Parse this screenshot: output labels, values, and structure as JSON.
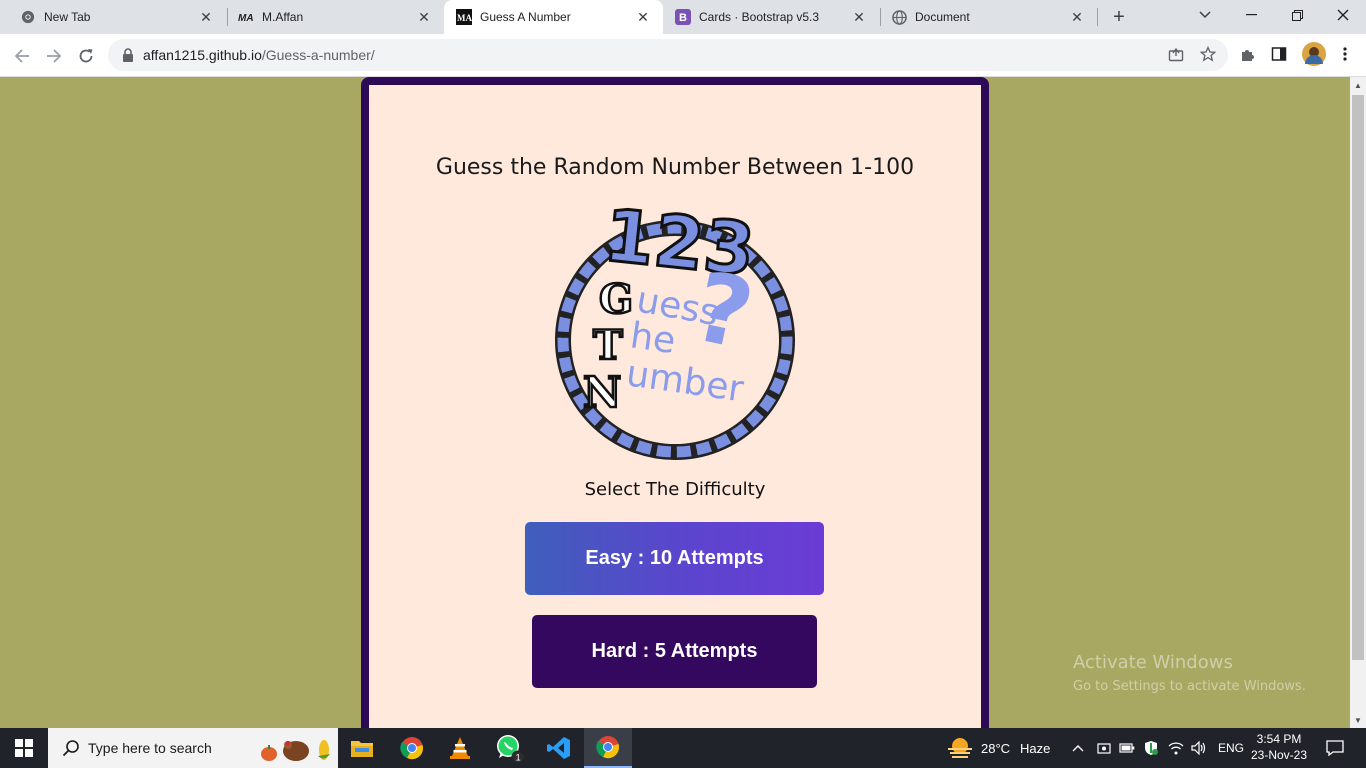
{
  "browser": {
    "tabs": [
      {
        "title": "New Tab",
        "icon": "chrome-icon"
      },
      {
        "title": "M.Affan",
        "icon": "ma-logo-icon"
      },
      {
        "title": "Guess A Number",
        "icon": "ma-black-logo-icon",
        "active": true
      },
      {
        "title": "Cards · Bootstrap v5.3",
        "icon": "bootstrap-icon"
      },
      {
        "title": "Document",
        "icon": "globe-icon"
      }
    ],
    "url_host": "affan1215.github.io",
    "url_path": "/Guess-a-number/"
  },
  "page": {
    "heading": "Guess the Random Number Between 1-100",
    "logo": {
      "number_text": "123",
      "letters": [
        "G",
        "T",
        "N"
      ],
      "words": [
        "uess",
        "he",
        "umber"
      ],
      "question": "?"
    },
    "subheading": "Select The Difficulty",
    "easy_label": "Easy : 10 Attempts",
    "hard_label": "Hard : 5 Attempts",
    "colors": {
      "background": "#a8a862",
      "card_border": "#2d0a57",
      "card": "#ffe8dc",
      "easy_from": "#3f5fbb",
      "easy_to": "#6b3cd6",
      "hard": "#34085e",
      "logo_blue": "#7b8fe0"
    }
  },
  "watermark": {
    "line1": "Activate Windows",
    "line2": "Go to Settings to activate Windows."
  },
  "taskbar": {
    "search_placeholder": "Type here to search",
    "weather_temp": "28°C",
    "weather_text": "Haze",
    "language": "ENG",
    "time": "3:54 PM",
    "date": "23-Nov-23",
    "whatsapp_badge": "1"
  }
}
